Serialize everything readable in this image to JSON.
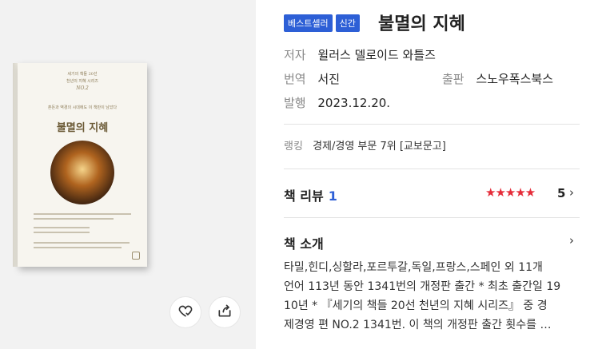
{
  "book_cover": {
    "series_small": "세기의 책들 20선",
    "subtitle_small": "천년의 지혜 시리즈",
    "number": "NO.2",
    "tagline_1": "혼돈과 역경의 시대에도 이 책만이 남았다",
    "tagline_2": "",
    "cover_title": "불멸의 지혜"
  },
  "actions": {
    "wishlist_icon": "heart-check-icon",
    "share_icon": "share-icon"
  },
  "header": {
    "badges": [
      "베스트셀러",
      "신간"
    ],
    "title": "불멸의 지혜"
  },
  "meta": {
    "author_label": "저자",
    "author": "윌러스 델로이드 와틀즈",
    "translator_label": "번역",
    "translator": "서진",
    "publisher_label": "출판",
    "publisher": "스노우폭스북스",
    "date_label": "발행",
    "date": "2023.12.20."
  },
  "ranking": {
    "label": "랭킹",
    "value": "경제/경영 부문 7위 [교보문고]"
  },
  "review": {
    "title": "책 리뷰",
    "count": "1",
    "stars": "★★★★★",
    "rating": "5",
    "rating_value": 5
  },
  "intro": {
    "title": "책 소개",
    "lines": [
      "타밀,힌디,싱할라,포르투갈,독일,프랑스,스페인 외 11개",
      "언어 113년 동안 1341번의 개정판 출간 * 최초 출간일 19",
      "10년 * 『세기의 책들 20선 천년의 지혜 시리즈』 중 경",
      "제경영 편 NO.2 1341번. 이 책의 개정판 출간 횟수를 …"
    ]
  },
  "colors": {
    "accent_blue": "#2d5fd6",
    "star_red": "#e52d3a"
  }
}
